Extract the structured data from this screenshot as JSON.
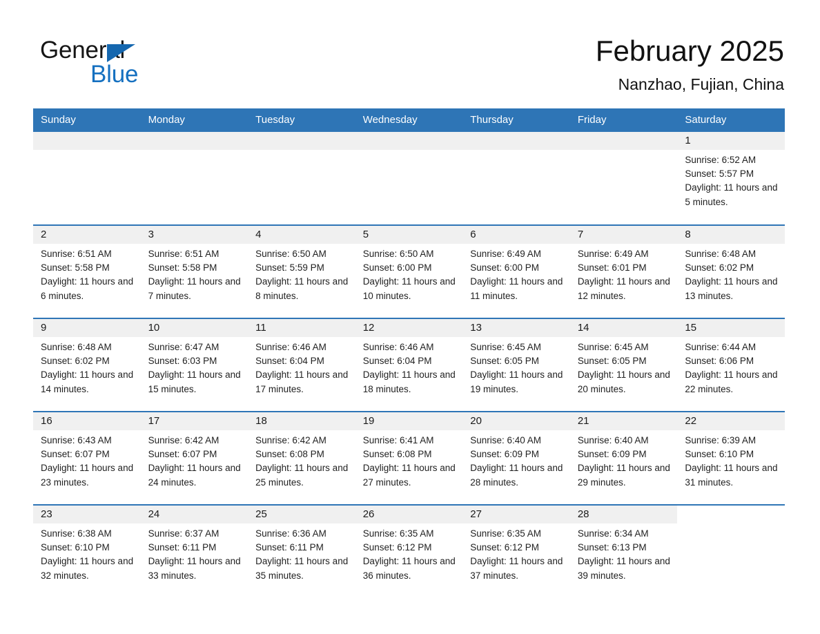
{
  "brand": {
    "line1": "General",
    "line2": "Blue",
    "triangle_color": "#1567af",
    "blue_color": "#1570c0"
  },
  "header": {
    "title": "February 2025",
    "subtitle": "Nanzhao, Fujian, China"
  },
  "theme": {
    "header_blue": "#2e75b6",
    "row_divider_blue": "#2e75b6",
    "daynum_bg": "#f0f0f0",
    "page_bg": "#ffffff",
    "text": "#1a1a1a"
  },
  "weekday_headers": [
    "Sunday",
    "Monday",
    "Tuesday",
    "Wednesday",
    "Thursday",
    "Friday",
    "Saturday"
  ],
  "labels": {
    "sunrise_prefix": "Sunrise:",
    "sunset_prefix": "Sunset:",
    "daylight_prefix": "Daylight:"
  },
  "weeks": [
    [
      {
        "day": "",
        "empty": true
      },
      {
        "day": "",
        "empty": true
      },
      {
        "day": "",
        "empty": true
      },
      {
        "day": "",
        "empty": true
      },
      {
        "day": "",
        "empty": true
      },
      {
        "day": "",
        "empty": true
      },
      {
        "day": "1",
        "sunrise": "Sunrise: 6:52 AM",
        "sunset": "Sunset: 5:57 PM",
        "daylight": "Daylight: 11 hours and 5 minutes."
      }
    ],
    [
      {
        "day": "2",
        "sunrise": "Sunrise: 6:51 AM",
        "sunset": "Sunset: 5:58 PM",
        "daylight": "Daylight: 11 hours and 6 minutes."
      },
      {
        "day": "3",
        "sunrise": "Sunrise: 6:51 AM",
        "sunset": "Sunset: 5:58 PM",
        "daylight": "Daylight: 11 hours and 7 minutes."
      },
      {
        "day": "4",
        "sunrise": "Sunrise: 6:50 AM",
        "sunset": "Sunset: 5:59 PM",
        "daylight": "Daylight: 11 hours and 8 minutes."
      },
      {
        "day": "5",
        "sunrise": "Sunrise: 6:50 AM",
        "sunset": "Sunset: 6:00 PM",
        "daylight": "Daylight: 11 hours and 10 minutes."
      },
      {
        "day": "6",
        "sunrise": "Sunrise: 6:49 AM",
        "sunset": "Sunset: 6:00 PM",
        "daylight": "Daylight: 11 hours and 11 minutes."
      },
      {
        "day": "7",
        "sunrise": "Sunrise: 6:49 AM",
        "sunset": "Sunset: 6:01 PM",
        "daylight": "Daylight: 11 hours and 12 minutes."
      },
      {
        "day": "8",
        "sunrise": "Sunrise: 6:48 AM",
        "sunset": "Sunset: 6:02 PM",
        "daylight": "Daylight: 11 hours and 13 minutes."
      }
    ],
    [
      {
        "day": "9",
        "sunrise": "Sunrise: 6:48 AM",
        "sunset": "Sunset: 6:02 PM",
        "daylight": "Daylight: 11 hours and 14 minutes."
      },
      {
        "day": "10",
        "sunrise": "Sunrise: 6:47 AM",
        "sunset": "Sunset: 6:03 PM",
        "daylight": "Daylight: 11 hours and 15 minutes."
      },
      {
        "day": "11",
        "sunrise": "Sunrise: 6:46 AM",
        "sunset": "Sunset: 6:04 PM",
        "daylight": "Daylight: 11 hours and 17 minutes."
      },
      {
        "day": "12",
        "sunrise": "Sunrise: 6:46 AM",
        "sunset": "Sunset: 6:04 PM",
        "daylight": "Daylight: 11 hours and 18 minutes."
      },
      {
        "day": "13",
        "sunrise": "Sunrise: 6:45 AM",
        "sunset": "Sunset: 6:05 PM",
        "daylight": "Daylight: 11 hours and 19 minutes."
      },
      {
        "day": "14",
        "sunrise": "Sunrise: 6:45 AM",
        "sunset": "Sunset: 6:05 PM",
        "daylight": "Daylight: 11 hours and 20 minutes."
      },
      {
        "day": "15",
        "sunrise": "Sunrise: 6:44 AM",
        "sunset": "Sunset: 6:06 PM",
        "daylight": "Daylight: 11 hours and 22 minutes."
      }
    ],
    [
      {
        "day": "16",
        "sunrise": "Sunrise: 6:43 AM",
        "sunset": "Sunset: 6:07 PM",
        "daylight": "Daylight: 11 hours and 23 minutes."
      },
      {
        "day": "17",
        "sunrise": "Sunrise: 6:42 AM",
        "sunset": "Sunset: 6:07 PM",
        "daylight": "Daylight: 11 hours and 24 minutes."
      },
      {
        "day": "18",
        "sunrise": "Sunrise: 6:42 AM",
        "sunset": "Sunset: 6:08 PM",
        "daylight": "Daylight: 11 hours and 25 minutes."
      },
      {
        "day": "19",
        "sunrise": "Sunrise: 6:41 AM",
        "sunset": "Sunset: 6:08 PM",
        "daylight": "Daylight: 11 hours and 27 minutes."
      },
      {
        "day": "20",
        "sunrise": "Sunrise: 6:40 AM",
        "sunset": "Sunset: 6:09 PM",
        "daylight": "Daylight: 11 hours and 28 minutes."
      },
      {
        "day": "21",
        "sunrise": "Sunrise: 6:40 AM",
        "sunset": "Sunset: 6:09 PM",
        "daylight": "Daylight: 11 hours and 29 minutes."
      },
      {
        "day": "22",
        "sunrise": "Sunrise: 6:39 AM",
        "sunset": "Sunset: 6:10 PM",
        "daylight": "Daylight: 11 hours and 31 minutes."
      }
    ],
    [
      {
        "day": "23",
        "sunrise": "Sunrise: 6:38 AM",
        "sunset": "Sunset: 6:10 PM",
        "daylight": "Daylight: 11 hours and 32 minutes."
      },
      {
        "day": "24",
        "sunrise": "Sunrise: 6:37 AM",
        "sunset": "Sunset: 6:11 PM",
        "daylight": "Daylight: 11 hours and 33 minutes."
      },
      {
        "day": "25",
        "sunrise": "Sunrise: 6:36 AM",
        "sunset": "Sunset: 6:11 PM",
        "daylight": "Daylight: 11 hours and 35 minutes."
      },
      {
        "day": "26",
        "sunrise": "Sunrise: 6:35 AM",
        "sunset": "Sunset: 6:12 PM",
        "daylight": "Daylight: 11 hours and 36 minutes."
      },
      {
        "day": "27",
        "sunrise": "Sunrise: 6:35 AM",
        "sunset": "Sunset: 6:12 PM",
        "daylight": "Daylight: 11 hours and 37 minutes."
      },
      {
        "day": "28",
        "sunrise": "Sunrise: 6:34 AM",
        "sunset": "Sunset: 6:13 PM",
        "daylight": "Daylight: 11 hours and 39 minutes."
      },
      {
        "day": "",
        "blank": true
      }
    ]
  ]
}
